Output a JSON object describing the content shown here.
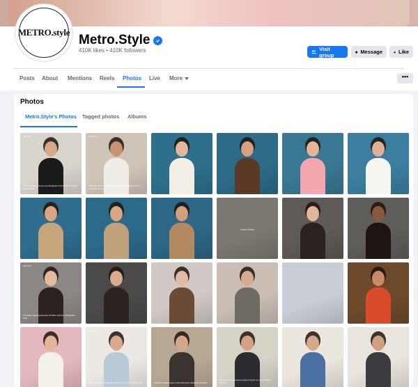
{
  "page": {
    "name": "Metro.Style",
    "avatar_text": "METRO.style",
    "stats": "410K likes • 410K followers",
    "buttons": {
      "visit_group": "Visit group",
      "message": "Message",
      "like": "Like"
    }
  },
  "nav": {
    "tabs": [
      "Posts",
      "About",
      "Mentions",
      "Reels",
      "Photos",
      "Live",
      "More"
    ],
    "active": "Photos",
    "more_menu": "•••"
  },
  "photos": {
    "title": "Photos",
    "sub_tabs": [
      "Metro.Style's Photos",
      "Tagged photos",
      "Albums"
    ],
    "tiles": [
      {
        "bg": "#d9d4cc",
        "fig": "#1b1b1b",
        "skin": "#d6a98a",
        "caption": "10 Things About Seven Jose Burghardt, Star Of 2023 Drama Dubbed Dark",
        "logo": "METRO"
      },
      {
        "bg": "#cfc4b8",
        "fig": "#f0ede6",
        "skin": "#c99373",
        "caption": "This Was The Plague Of Young Filipino Wealth Says Rob Pronounce Reports",
        "logo": "METRO"
      },
      {
        "bg": "#2e6f8b",
        "fig": "#f4efe6",
        "skin": "#e2b89b",
        "caption": "",
        "logo": ""
      },
      {
        "bg": "#2d6b88",
        "fig": "#5a3a26",
        "skin": "#d4a07f",
        "caption": "",
        "logo": ""
      },
      {
        "bg": "#3a7792",
        "fig": "#f2a7b0",
        "skin": "#e4b597",
        "caption": "",
        "logo": ""
      },
      {
        "bg": "#3b7ea0",
        "fig": "#f7f5f0",
        "skin": "#e0b093",
        "caption": "",
        "logo": ""
      },
      {
        "bg": "#2f6d8d",
        "fig": "#c7a67b",
        "skin": "#d9a582",
        "caption": "",
        "logo": ""
      },
      {
        "bg": "#2d6a8a",
        "fig": "#c2a27d",
        "skin": "#d8a585",
        "caption": "",
        "logo": ""
      },
      {
        "bg": "#2c6785",
        "fig": "#b3895f",
        "skin": "#d3a07e",
        "caption": "",
        "logo": ""
      },
      {
        "bg": "#7c7771",
        "fig": "",
        "skin": "",
        "caption": "",
        "logo": "",
        "center": "Vocal Coach"
      },
      {
        "bg": "#5d5a57",
        "fig": "#2a2220",
        "skin": "#e0b799",
        "caption": "",
        "logo": ""
      },
      {
        "bg": "#5f5d5a",
        "fig": "#1d1512",
        "skin": "#8a5a3c",
        "caption": "",
        "logo": ""
      },
      {
        "bg": "#8c8784",
        "fig": "#2c2320",
        "skin": "#e5b99e",
        "caption": "The Most Stunning Beauties Of Miss Universe Philippines 2024",
        "logo": "METRO"
      },
      {
        "bg": "#4b4a49",
        "fig": "#2b2320",
        "skin": "#d8ab8f",
        "caption": "",
        "logo": ""
      },
      {
        "bg": "#cfc8c4",
        "fig": "#6b4a36",
        "skin": "#e3bba2",
        "caption": "",
        "logo": ""
      },
      {
        "bg": "#c9bdb5",
        "fig": "#6f6a62",
        "skin": "#d7ab8e",
        "caption": "",
        "logo": ""
      },
      {
        "bg": "#c9cdd6",
        "fig": "",
        "skin": "",
        "caption": "",
        "logo": ""
      },
      {
        "bg": "#6d4a2c",
        "fig": "#d94b2a",
        "skin": "#c78c66",
        "caption": "",
        "logo": ""
      },
      {
        "bg": "#e4b9bd",
        "fig": "#f3f0ea",
        "skin": "#e3b497",
        "caption": "",
        "logo": ""
      },
      {
        "bg": "#ece9e4",
        "fig": "#b9c9d8",
        "skin": "#d9aa8c",
        "caption": "Truth and Style: The Glamorous Gowns of the Filipino Elite",
        "logo": "METRO"
      },
      {
        "bg": "#b7a894",
        "fig": "#3b3330",
        "skin": "#d6a58a",
        "caption": "Tribute to Manila Style Icons Who Have Redefined Fashion",
        "logo": ""
      },
      {
        "bg": "#d7d2c8",
        "fig": "#2c2c30",
        "skin": "#d4a283",
        "caption": "Can These Celebs Keep Going In Style? A Look At Their Outfits",
        "logo": ""
      },
      {
        "bg": "#ebe7df",
        "fig": "#4b6fa1",
        "skin": "#d7a98b",
        "caption": "",
        "logo": ""
      },
      {
        "bg": "#e9e5de",
        "fig": "#3c3c40",
        "skin": "#cf9f80",
        "caption": "",
        "logo": ""
      }
    ]
  }
}
